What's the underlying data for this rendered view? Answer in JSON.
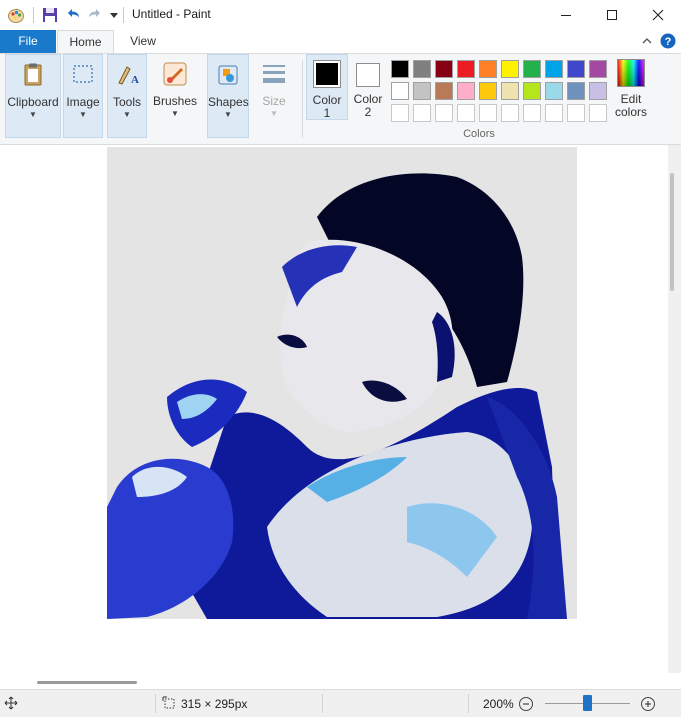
{
  "window": {
    "title": "Untitled - Paint"
  },
  "tabs": {
    "file": "File",
    "home": "Home",
    "view": "View"
  },
  "ribbon": {
    "groups": {
      "clipboard": "Clipboard",
      "image": "Image",
      "tools": "Tools",
      "brushes": "Brushes",
      "shapes": "Shapes",
      "size": "Size"
    },
    "color1": {
      "line1": "Color",
      "line2": "1",
      "value": "#000000"
    },
    "color2": {
      "line1": "Color",
      "line2": "2",
      "value": "#ffffff"
    },
    "colors_label": "Colors",
    "edit_colors": {
      "line1": "Edit",
      "line2": "colors"
    },
    "palette_row1": [
      "#000000",
      "#7f7f7f",
      "#880015",
      "#ed1c24",
      "#ff7f27",
      "#fff200",
      "#22b14c",
      "#00a2e8",
      "#3f48cc",
      "#a349a4"
    ],
    "palette_row2": [
      "#ffffff",
      "#c3c3c3",
      "#b97a57",
      "#ffaec9",
      "#ffc90e",
      "#efe4b0",
      "#b5e61d",
      "#99d9ea",
      "#7092be",
      "#c8bfe7"
    ]
  },
  "canvas": {
    "description_name": "pixelated blue portrait image"
  },
  "statusbar": {
    "image_size": "315 × 295px",
    "zoom": "200%",
    "zoom_level_fraction": 0.5
  }
}
